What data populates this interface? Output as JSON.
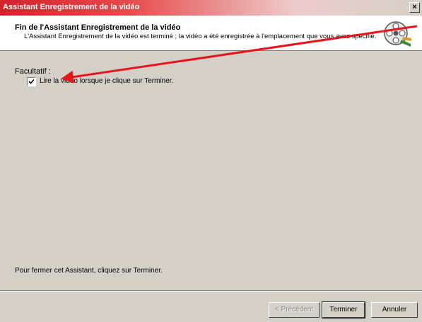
{
  "window": {
    "title": "Assistant Enregistrement de la vidéo",
    "close_glyph": "×"
  },
  "header": {
    "title": "Fin de l'Assistant Enregistrement de la vidéo",
    "subtitle": "L'Assistant Enregistrement de la vidéo est terminé ; la vidéo a été enregistrée à l'emplacement que vous avez spécifié.",
    "icon": "film-reel-icon"
  },
  "options": {
    "label": "Facultatif :",
    "play_video": {
      "checked": true,
      "label": "Lire la vidéo lorsque je clique sur Terminer."
    }
  },
  "footer": {
    "hint": "Pour fermer cet Assistant, cliquez sur Terminer."
  },
  "buttons": {
    "previous": "< Précédent",
    "finish": "Terminer",
    "cancel": "Annuler"
  },
  "colors": {
    "titlebar_start": "#d4222c",
    "dialog_bg": "#d4d0c8",
    "annotation_arrow": "#e8141c"
  }
}
